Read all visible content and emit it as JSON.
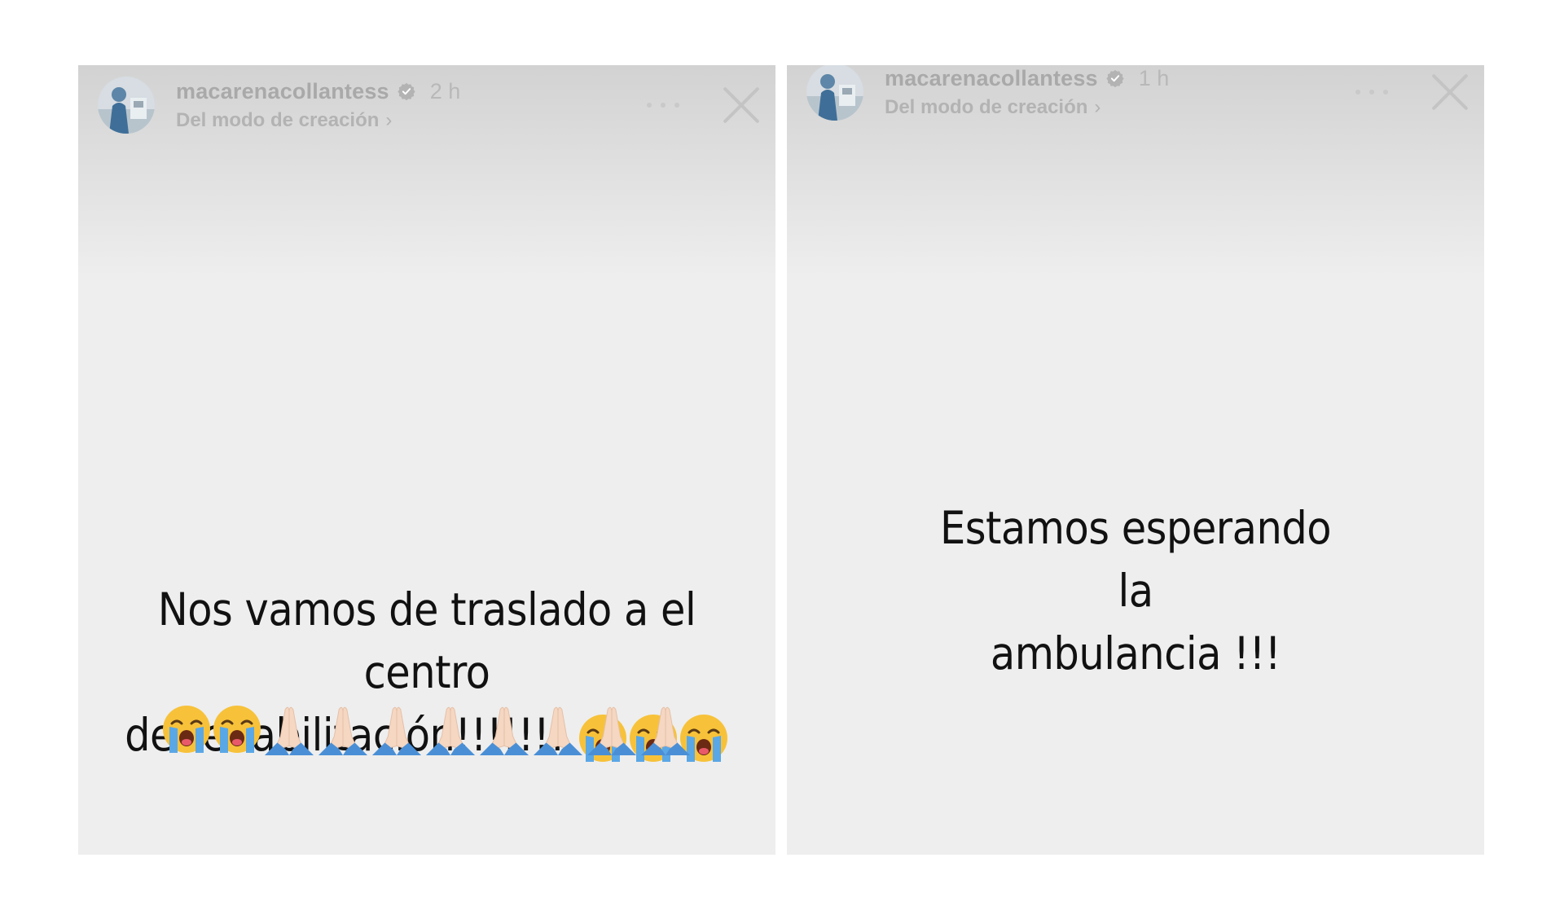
{
  "stories": [
    {
      "username": "macarenacollantess",
      "time": "2 h",
      "subline": "Del modo de creación",
      "subline_chevron": "›",
      "text_line1": "Nos vamos de traslado a el centro",
      "text_line2": "de rehabilitación!!!!!!!",
      "emojis": {
        "line2_cry_count": 3,
        "line3_cry_count": 2,
        "line3_pray_count": 8
      }
    },
    {
      "username": "macarenacollantess",
      "time": "1 h",
      "subline": "Del modo de creación",
      "subline_chevron": "›",
      "text_line1": "Estamos esperando la",
      "text_line2": "ambulancia !!!"
    }
  ],
  "icons": {
    "verified": "verified-badge-icon",
    "more": "more-options-icon",
    "close": "close-icon",
    "cry": "loudly-crying-face-emoji",
    "pray": "folded-hands-emoji"
  },
  "colors": {
    "background": "#ffffff",
    "story_bg": "#eeeeee",
    "header_text": "#a9a9a9",
    "story_text": "#111111",
    "emoji_yellow": "#f7c23a",
    "emoji_tears": "#5aa7e6",
    "pray_skin": "#f5d7c2",
    "pray_sleeve": "#4a8fd6"
  }
}
